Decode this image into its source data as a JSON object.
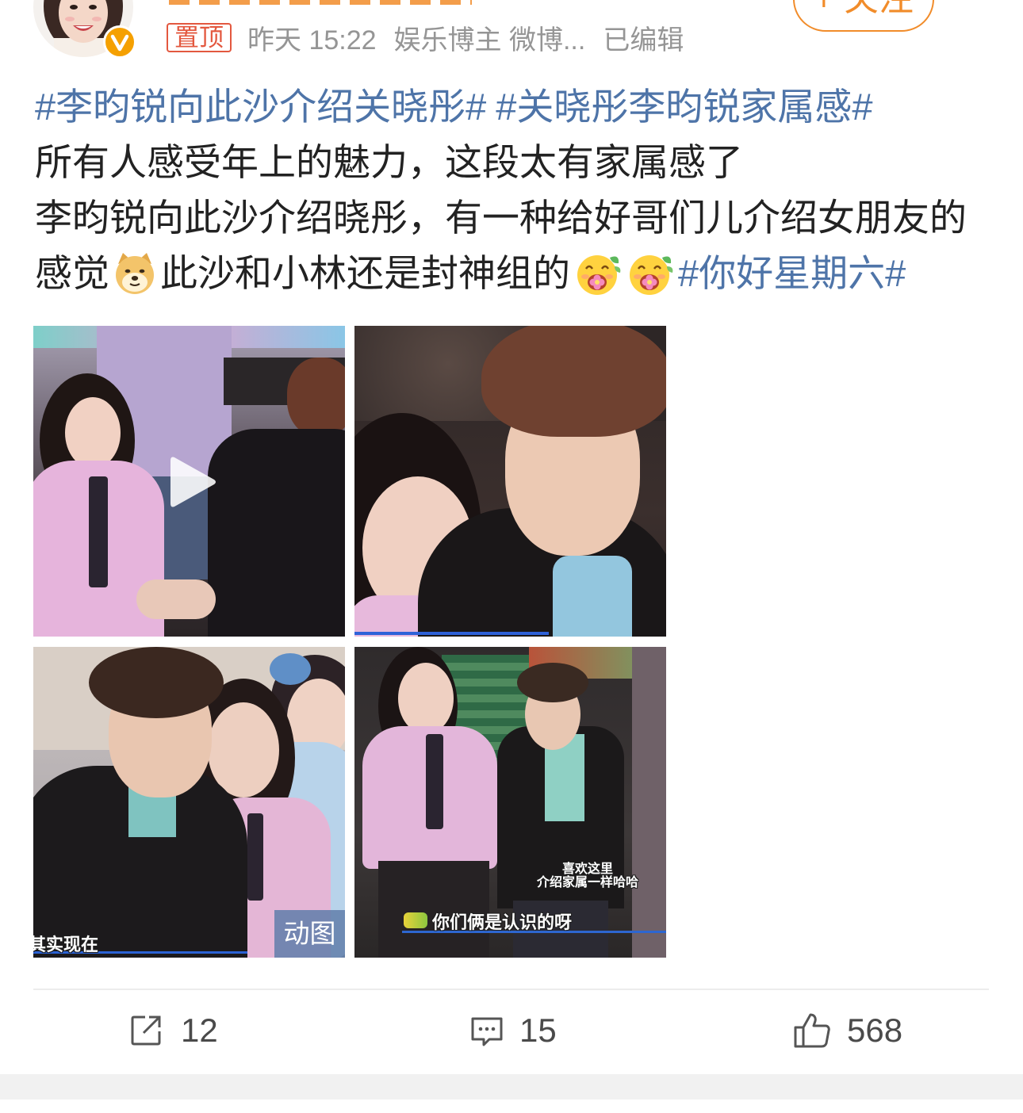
{
  "header": {
    "follow_label": "+ 关注",
    "pinned_label": "置顶",
    "time": "昨天 15:22",
    "source": "娱乐博主 微博...",
    "edited": "已编辑",
    "verified_icon": "verified-badge-icon"
  },
  "post": {
    "hashtag_1": "#李昀锐向此沙介绍关晓彤#",
    "hashtag_2": "#关晓彤李昀锐家属感#",
    "line_1": "所有人感受年上的魅力，这段太有家属感了",
    "line_2": "李昀锐向此沙介绍晓彤，有一种给好哥们儿介绍女朋友的",
    "line_3_start": "感觉",
    "line_3_middle": "此沙和小林还是封神组的",
    "hashtag_3": "#你好星期六#",
    "emojis": [
      "doge-emoji-icon",
      "flower-face-emoji-icon",
      "flower-face-emoji-icon"
    ]
  },
  "media": [
    {
      "overlay_icon": "play-icon"
    },
    {},
    {
      "badge": "动图",
      "captions": [
        "其实现在"
      ]
    },
    {
      "captions": [
        "喜欢这里",
        "介绍家属一样哈哈",
        "你们俩是认识的呀"
      ]
    }
  ],
  "actions": {
    "share": {
      "icon": "share-icon",
      "count": "12"
    },
    "comment": {
      "icon": "comment-icon",
      "count": "15"
    },
    "like": {
      "icon": "thumbs-up-icon",
      "count": "568"
    }
  },
  "colors": {
    "accent": "#f18c2a",
    "pinned": "#e3583f",
    "hashtag": "#4e74a8",
    "text": "#222222",
    "meta": "#959595",
    "icon": "#555555",
    "count": "#4a4a4a",
    "verified": "#f5a000"
  }
}
